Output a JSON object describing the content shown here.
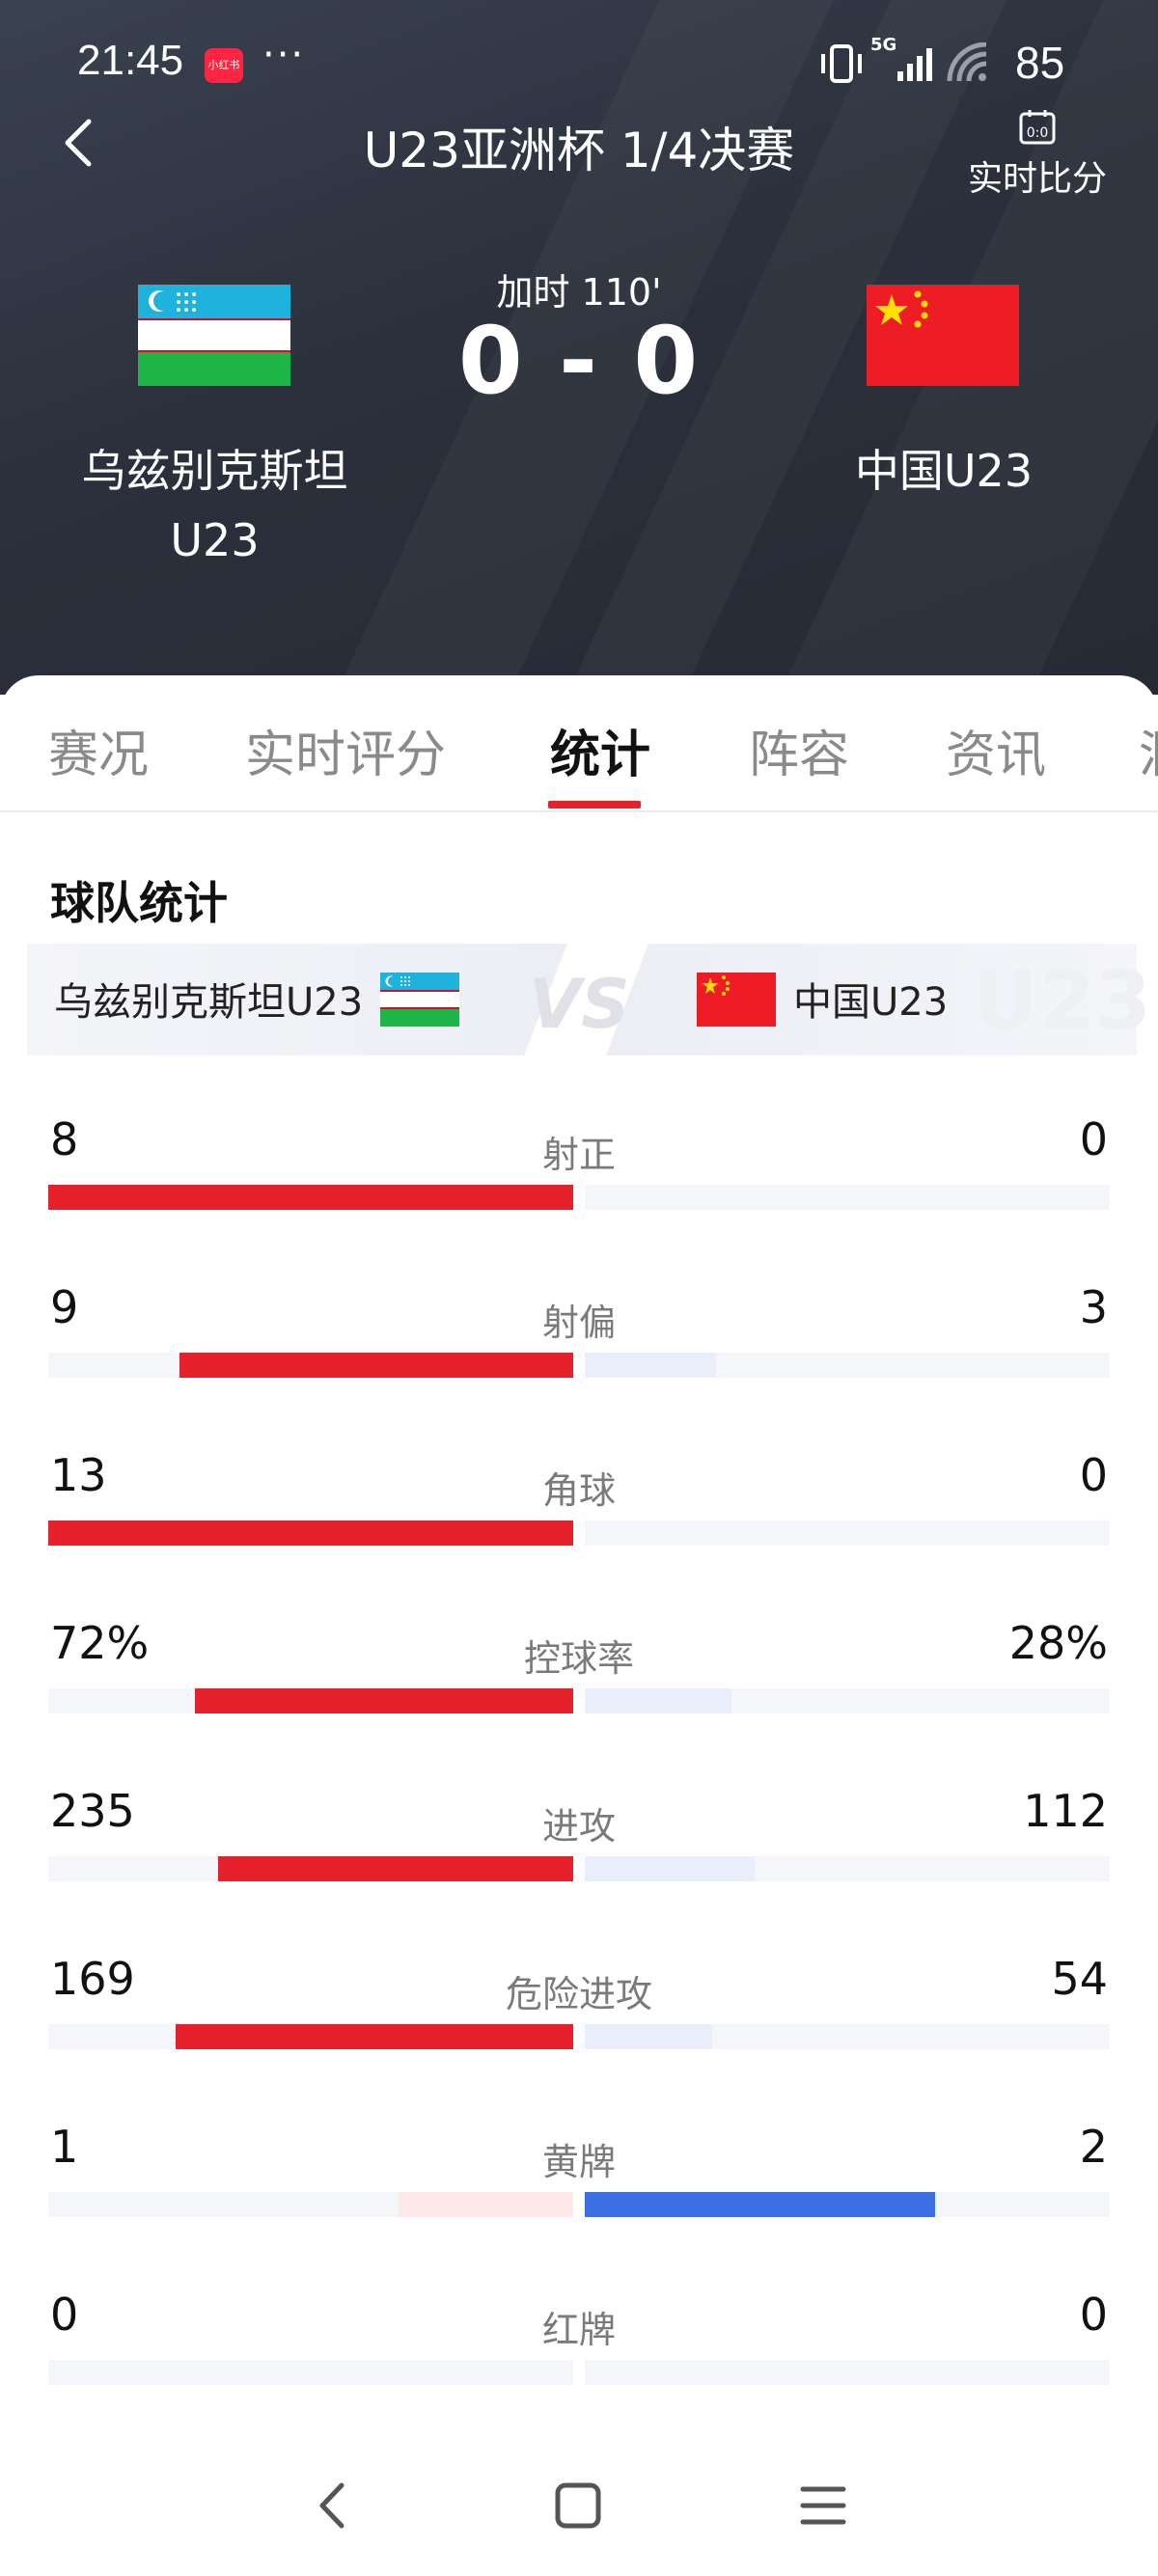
{
  "status_bar": {
    "time": "21:45",
    "app_badge": "小红书",
    "more": "···",
    "network": "5G",
    "battery": "85"
  },
  "header": {
    "title": "U23亚洲杯 1/4决赛",
    "live_score_label": "实时比分",
    "match_status": "加时 110'",
    "score": "0 - 0",
    "home_team": "乌兹别克斯坦U23",
    "away_team": "中国U23"
  },
  "tabs": [
    {
      "label": "赛况",
      "active": false
    },
    {
      "label": "实时评分",
      "active": false
    },
    {
      "label": "统计",
      "active": true
    },
    {
      "label": "阵容",
      "active": false
    },
    {
      "label": "资讯",
      "active": false
    },
    {
      "label": "洞",
      "active": false
    }
  ],
  "team_stats": {
    "section_title": "球队统计",
    "home_name": "乌兹别克斯坦U23",
    "vs": "VS",
    "away_name": "中国U23",
    "watermark": "U23",
    "rows": [
      {
        "label": "射正",
        "home": "8",
        "away": "0",
        "home_share": 1.0,
        "away_share": 0.0
      },
      {
        "label": "射偏",
        "home": "9",
        "away": "3",
        "home_share": 0.75,
        "away_share": 0.25
      },
      {
        "label": "角球",
        "home": "13",
        "away": "0",
        "home_share": 1.0,
        "away_share": 0.0
      },
      {
        "label": "控球率",
        "home": "72%",
        "away": "28%",
        "home_share": 0.72,
        "away_share": 0.28
      },
      {
        "label": "进攻",
        "home": "235",
        "away": "112",
        "home_share": 0.677,
        "away_share": 0.323
      },
      {
        "label": "危险进攻",
        "home": "169",
        "away": "54",
        "home_share": 0.758,
        "away_share": 0.242
      },
      {
        "label": "黄牌",
        "home": "1",
        "away": "2",
        "home_share": 0.333,
        "away_share": 0.667,
        "highlight": "away"
      },
      {
        "label": "红牌",
        "home": "0",
        "away": "0",
        "home_share": 0.0,
        "away_share": 0.0
      }
    ]
  },
  "colors": {
    "home_bar": "#e5222c",
    "home_bar_weak": "#fde8e8",
    "away_bar": "#3b6ee0",
    "away_bar_weak": "#eaeefa",
    "accent": "#e5222c"
  },
  "nav_icons": [
    "back-icon",
    "home-icon",
    "menu-icon"
  ]
}
